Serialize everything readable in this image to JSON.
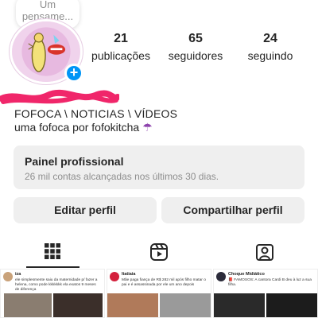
{
  "note": {
    "text": "Um pensame..."
  },
  "profile": {
    "add_story_label": "+",
    "stats": {
      "posts": {
        "count": "21",
        "label": "publicações"
      },
      "followers": {
        "count": "65",
        "label": "seguidores"
      },
      "following": {
        "count": "24",
        "label": "seguindo"
      }
    },
    "bio_line_1": "FOFOCA \\ NOTICIAS \\ VÍDEOS",
    "bio_line_2": "uma fofoca por fofokitcha",
    "bio_emoji": "☂"
  },
  "pro_panel": {
    "title": "Painel profissional",
    "subtitle": "26 mil contas alcançadas nos últimos 30 dias."
  },
  "actions": {
    "edit": "Editar perfil",
    "share": "Compartilhar perfil"
  },
  "tabs": [
    "grid",
    "reels",
    "tagged"
  ],
  "posts": [
    {
      "name": "iza",
      "text": "ele simplesmente saiu da maternidade p/ fazer a helena, como pode kkkkkkk ela exatos 9 meses de diferença"
    },
    {
      "name": "Itatiaia",
      "text": "Mãe paga fiança de R$ 282 mil após filho matar o pai e é assassinada por ele um ano depois"
    },
    {
      "name": "Choque Midiático",
      "text": "📕 FAMOSOS: A cantora Cardi B deu à luz a sua filha."
    }
  ],
  "colors": {
    "accent": "#0095f6",
    "panel_bg": "#efefef",
    "redact": "#f0266a"
  }
}
